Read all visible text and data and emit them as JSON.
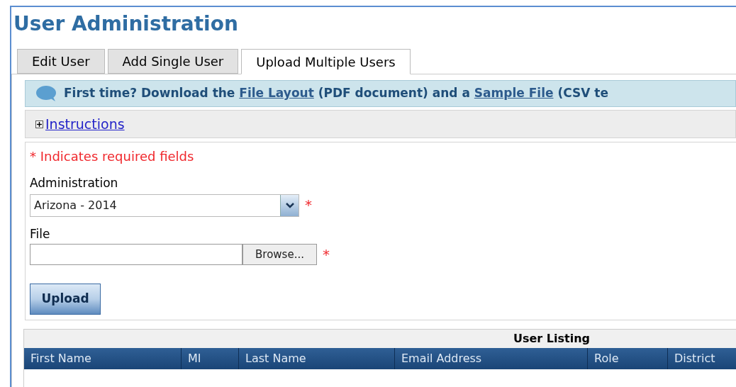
{
  "page_title": "User Administration",
  "tabs": [
    {
      "label": "Edit User",
      "selected": false
    },
    {
      "label": "Add Single User",
      "selected": false
    },
    {
      "label": "Upload Multiple Users",
      "selected": true
    }
  ],
  "banner": {
    "parts": [
      {
        "kind": "text",
        "text": "First time? Download the "
      },
      {
        "kind": "link",
        "text": "File Layout"
      },
      {
        "kind": "text",
        "text": " (PDF document) and a "
      },
      {
        "kind": "link",
        "text": "Sample File"
      },
      {
        "kind": "text",
        "text": " (CSV te"
      }
    ]
  },
  "instructions": {
    "label": "Instructions",
    "expanded": false
  },
  "required_note": "* Indicates required fields",
  "administration": {
    "label": "Administration",
    "value": "Arizona - 2014",
    "required_mark": "*"
  },
  "file": {
    "label": "File",
    "browse": "Browse...",
    "required_mark": "*"
  },
  "upload_button": "Upload",
  "table": {
    "title": "User Listing",
    "columns": [
      "First Name",
      "MI",
      "Last Name",
      "Email Address",
      "Role",
      "District"
    ]
  }
}
